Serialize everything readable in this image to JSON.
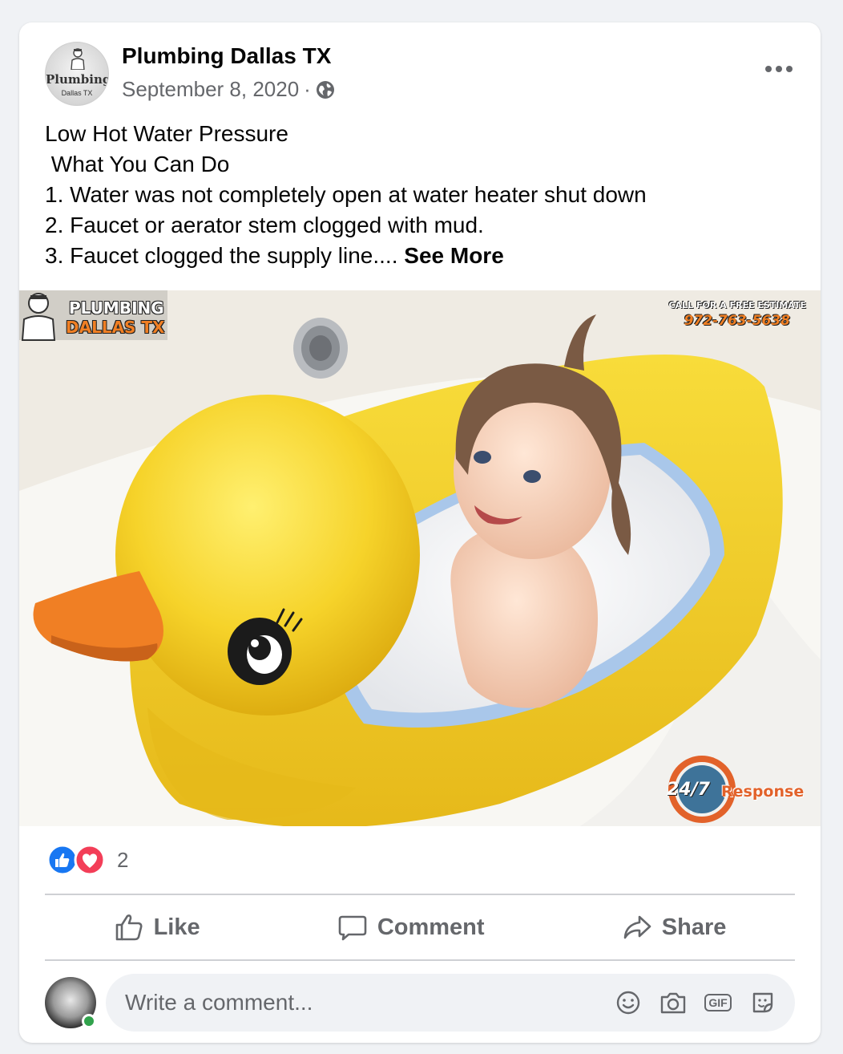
{
  "post": {
    "page_name": "Plumbing Dallas TX",
    "date": "September 8, 2020",
    "separator": "·",
    "privacy_icon": "globe-icon",
    "avatar_logo": {
      "word": "Plumbing",
      "sub": "Dallas TX"
    },
    "text": "Low Hot Water Pressure\n What You Can Do\n1. Water was not completely open at water heater shut down\n2. Faucet or aerator stem clogged with mud.\n3. Faucet clogged the supply line.... ",
    "see_more_label": "See More",
    "more_icon": "more-options-icon"
  },
  "photo": {
    "brand_line1": "PLUMBING",
    "brand_line2": "DALLAS TX",
    "estimate_label": "CALL FOR A FREE ESTIMATE",
    "phone": "972-763-5638",
    "badge_num": "24/7",
    "badge_word": "Response"
  },
  "reactions": {
    "icons": [
      "like-reaction-icon",
      "love-reaction-icon"
    ],
    "count": "2"
  },
  "actions": {
    "like_label": "Like",
    "comment_label": "Comment",
    "share_label": "Share"
  },
  "comment_input": {
    "placeholder": "Write a comment...",
    "icons": [
      "emoji-icon",
      "camera-icon",
      "gif-icon",
      "sticker-icon"
    ],
    "gif_text": "GIF"
  },
  "colors": {
    "accent": "#1877f2",
    "love": "#f33e58",
    "secondary_text": "#65676b",
    "duck_yellow": "#f6d32a",
    "duck_beak": "#f07f24",
    "online": "#31a24c"
  }
}
